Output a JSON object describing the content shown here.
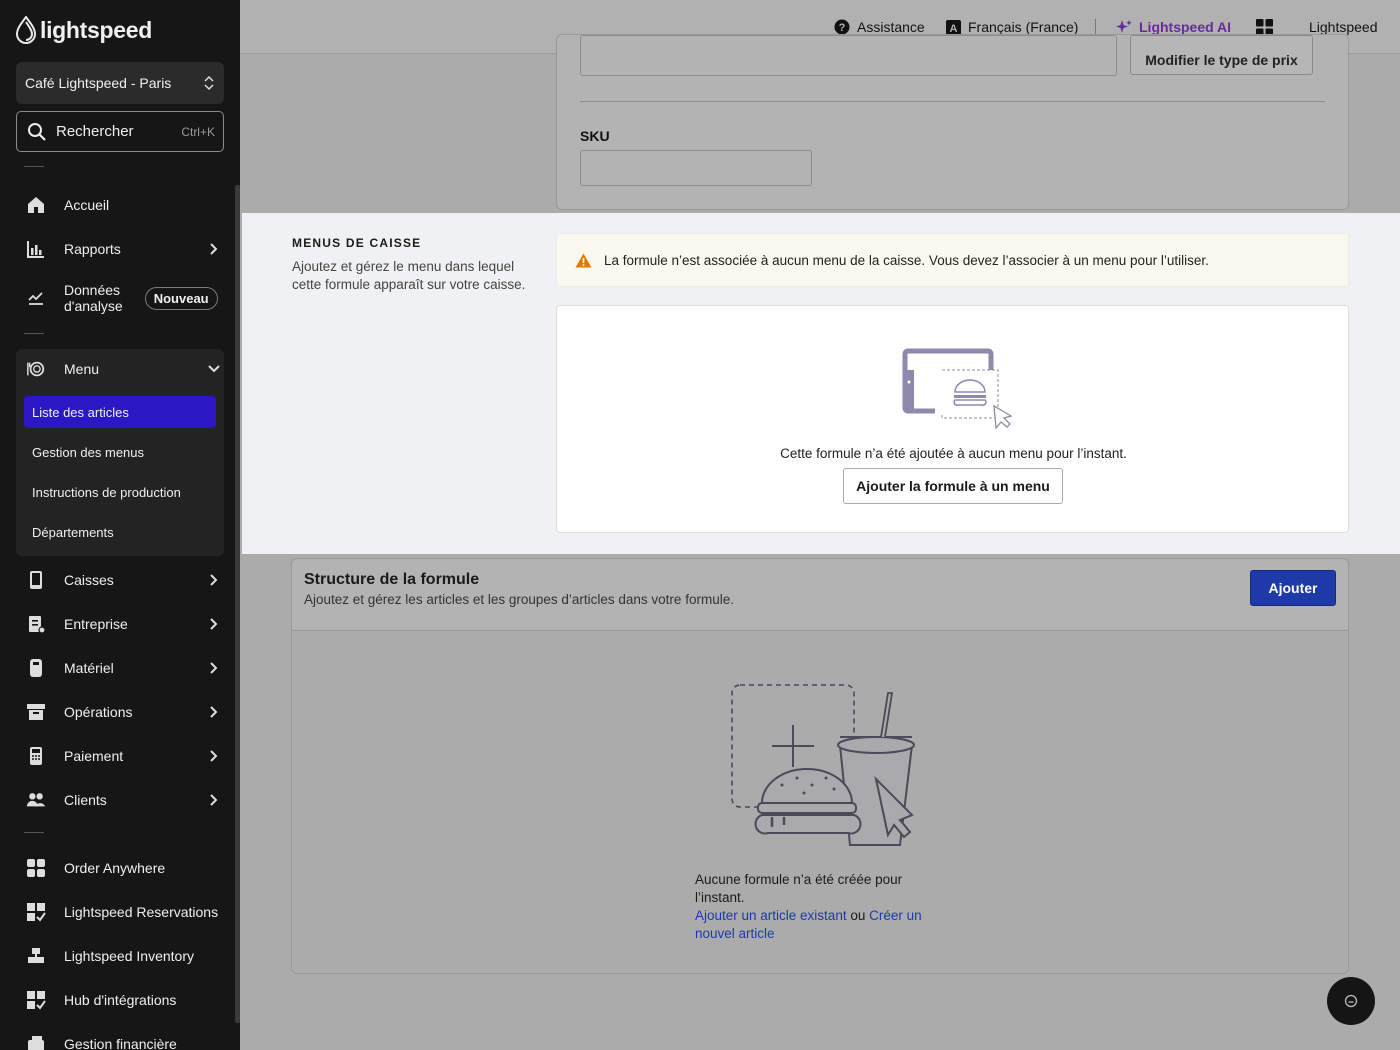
{
  "sidebar": {
    "logo_text": "lightspeed",
    "store": "Café Lightspeed - Paris",
    "search_placeholder": "Rechercher",
    "search_shortcut": "Ctrl+K",
    "items": {
      "home": "Accueil",
      "reports": "Rapports",
      "analytics_line1": "Données",
      "analytics_line2": "d'analyse",
      "analytics_badge": "Nouveau",
      "menu": "Menu",
      "registers": "Caisses",
      "business": "Entreprise",
      "hardware": "Matériel",
      "operations": "Opérations",
      "payment": "Paiement",
      "customers": "Clients",
      "order_anywhere": "Order Anywhere",
      "reservations": "Lightspeed Reservations",
      "inventory": "Lightspeed Inventory",
      "integrations": "Hub d'intégrations",
      "finance": "Gestion financière"
    },
    "submenu": {
      "items_list": "Liste des articles",
      "menus_management": "Gestion des menus",
      "production": "Instructions de production",
      "departments": "Départements"
    }
  },
  "topbar": {
    "help": "Assistance",
    "language": "Français (France)",
    "ai": "Lightspeed AI",
    "account": "Lightspeed"
  },
  "main": {
    "price_type_button": "Modifier le type de prix",
    "sku_label": "SKU",
    "sku_value": "",
    "pos_menus": {
      "title": "MENUS DE CAISSE",
      "description": "Ajoutez et gérez le menu dans lequel cette formule apparaît sur votre caisse.",
      "warning": "La formule n’est associée à aucun menu de la caisse. Vous devez l’associer à un menu pour l’utiliser.",
      "empty_text": "Cette formule n’a été ajoutée à aucun menu pour l’instant.",
      "add_button": "Ajouter la formule à un menu"
    },
    "structure": {
      "title": "Structure de la formule",
      "description": "Ajoutez et gérez les articles et les groupes d’articles dans votre formule.",
      "add_button": "Ajouter",
      "empty_text": "Aucune formule n’a été créée pour l’instant.",
      "link_existing": "Ajouter un article existant",
      "or": "ou",
      "link_create": "Créer un nouvel article"
    }
  },
  "colors": {
    "active_nav": "#2a18c4",
    "primary_button": "#1d3aa8",
    "ai_accent": "#6a2aa0",
    "warning_icon": "#e07b00"
  }
}
